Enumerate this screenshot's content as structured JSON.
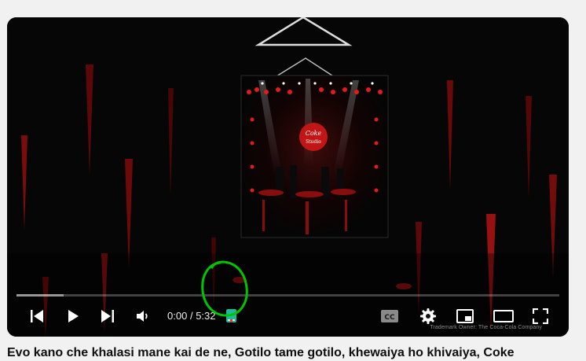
{
  "player": {
    "current_time": "0:00",
    "separator": "/",
    "duration": "5:32",
    "progress_fraction": 0,
    "buffered_fraction": 0.087,
    "trademark": "Trademark Owner: The Coca-Cola Company",
    "accent_color": "#ff0000",
    "stage_logo_text": [
      "Coke",
      "Studio"
    ],
    "controls": {
      "previous_icon": "skip-previous-icon",
      "play_icon": "play-icon",
      "next_icon": "skip-next-icon",
      "volume_icon": "volume-icon",
      "extension_icon": "book-icon",
      "captions_icon": "closed-captions-icon",
      "settings_icon": "gear-icon",
      "miniplayer_icon": "miniplayer-icon",
      "theater_icon": "theater-mode-icon",
      "fullscreen_icon": "fullscreen-icon"
    }
  },
  "annotation": {
    "color": "#00c400"
  },
  "video": {
    "title": "Evo kano che khalasi mane kai de ne, Gotilo tame gotilo, khewaiya ho khivaiya, Coke"
  }
}
